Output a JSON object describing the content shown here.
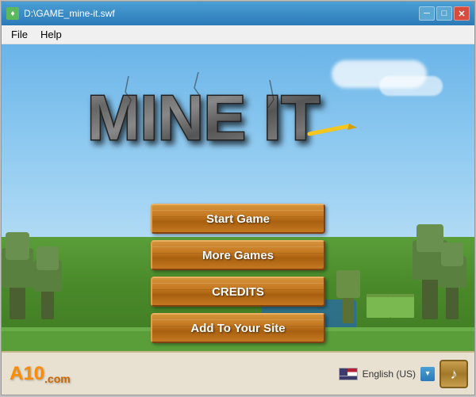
{
  "window": {
    "title": "D:\\GAME_mine-it.swf",
    "icon": "♦"
  },
  "titlebar": {
    "minimize": "─",
    "maximize": "□",
    "close": "✕"
  },
  "menubar": {
    "file_label": "File",
    "help_label": "Help"
  },
  "logo": {
    "text": "MINE IT"
  },
  "buttons": [
    {
      "id": "start-game",
      "label": "Start Game"
    },
    {
      "id": "more-games",
      "label": "More Games"
    },
    {
      "id": "credits",
      "label": "CREDITS"
    },
    {
      "id": "add-to-site",
      "label": "Add To Your Site"
    }
  ],
  "bottom": {
    "brand": "A10",
    "brand_suffix": ".com",
    "language": "English (US)",
    "music_icon": "♪"
  }
}
